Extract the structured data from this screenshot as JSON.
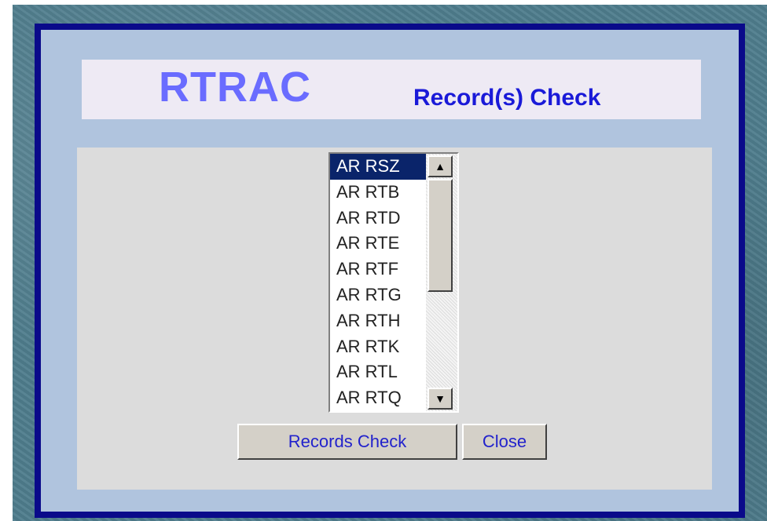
{
  "header": {
    "app_name": "RTRAC",
    "subtitle": "Record(s) Check"
  },
  "record_list": {
    "selected_index": 0,
    "items": [
      {
        "label": "AR RSZ"
      },
      {
        "label": "AR RTB"
      },
      {
        "label": "AR RTD"
      },
      {
        "label": "AR RTE"
      },
      {
        "label": "AR RTF"
      },
      {
        "label": "AR RTG"
      },
      {
        "label": "AR RTH"
      },
      {
        "label": "AR RTK"
      },
      {
        "label": "AR RTL"
      },
      {
        "label": "AR RTQ"
      }
    ],
    "scroll_up_icon": "▲",
    "scroll_down_icon": "▼"
  },
  "buttons": {
    "records_check": "Records Check",
    "close": "Close"
  },
  "colors": {
    "frame_border": "#0a0a8a",
    "title_main": "#6a6cff",
    "title_sub": "#1a1ad8",
    "selected_row": "#0a246a",
    "button_text": "#2222cc"
  }
}
